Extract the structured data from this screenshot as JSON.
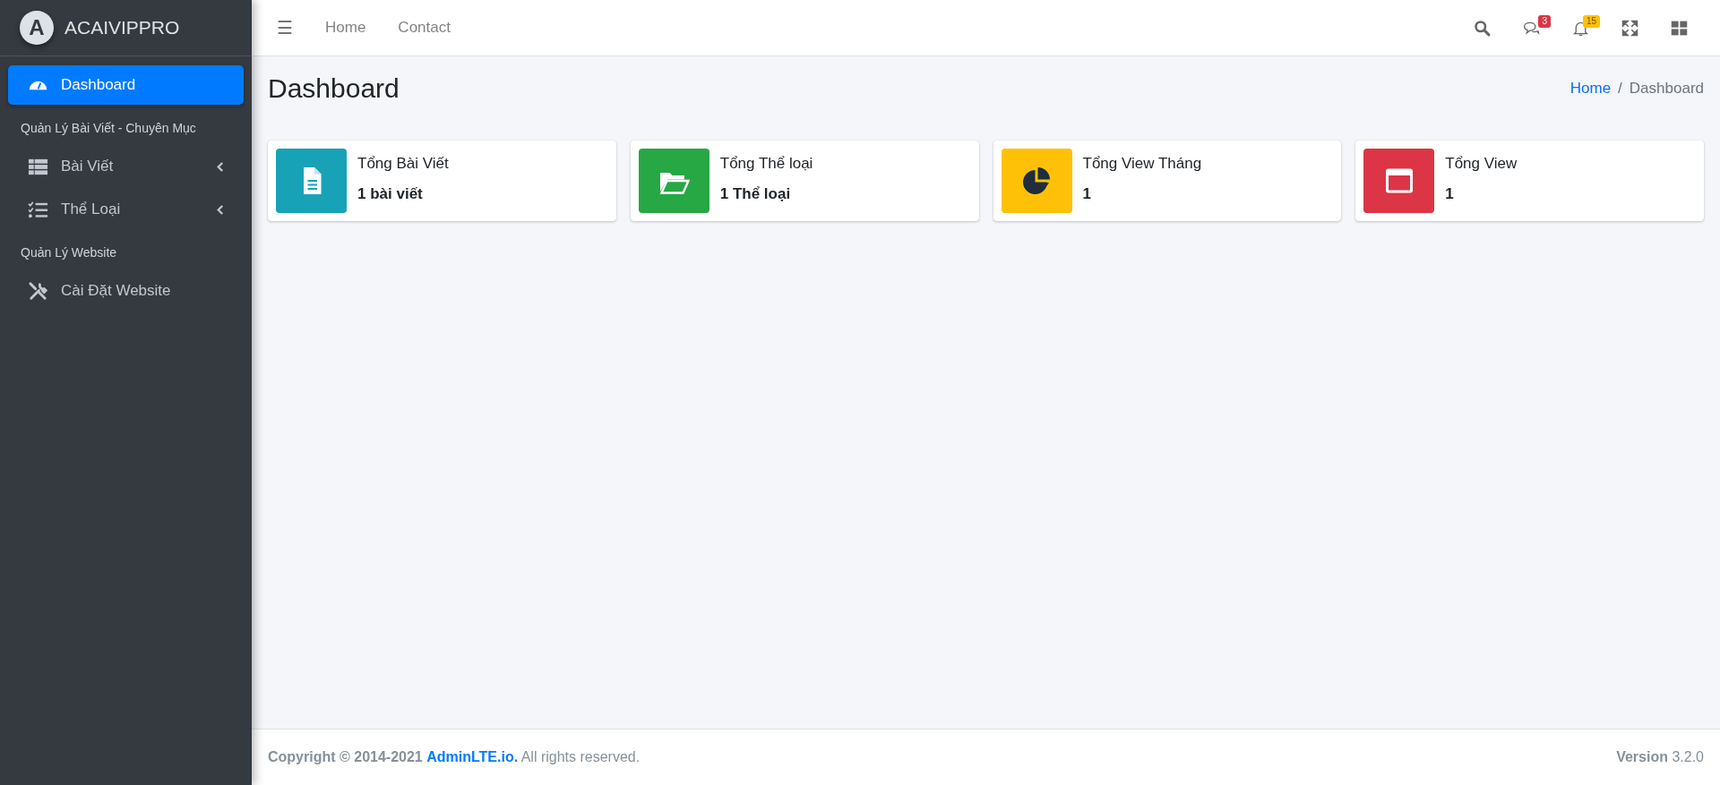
{
  "brand": {
    "initial": "A",
    "name": "ACAIVIPPRO"
  },
  "sidebar": {
    "items": [
      {
        "kind": "link",
        "label": "Dashboard",
        "selected": true,
        "expandable": false
      },
      {
        "kind": "header",
        "label": "Quản Lý Bài Viết - Chuyên Mục"
      },
      {
        "kind": "link",
        "label": "Bài Viết",
        "selected": false,
        "expandable": true
      },
      {
        "kind": "link",
        "label": "Thể Loại",
        "selected": false,
        "expandable": true
      },
      {
        "kind": "header",
        "label": "Quản Lý Website"
      },
      {
        "kind": "link",
        "label": "Cài Đặt Website",
        "selected": false,
        "expandable": false
      }
    ]
  },
  "navbar": {
    "menu_glyph": "☰",
    "links": [
      "Home",
      "Contact"
    ],
    "tools": [
      {
        "kind": "search"
      },
      {
        "kind": "messages",
        "badge": "3",
        "color": "#dc3545"
      },
      {
        "kind": "notifications",
        "badge": "15",
        "color": "#ffc107"
      },
      {
        "kind": "fullscreen"
      },
      {
        "kind": "apps"
      }
    ]
  },
  "page": {
    "title": "Dashboard",
    "breadcrumb_separator": "/",
    "breadcrumb": [
      {
        "label": "Home",
        "selected": false
      },
      {
        "label": "Dashboard",
        "selected": true
      }
    ]
  },
  "info_boxes": [
    {
      "kind": "document",
      "color": "#17a2b8",
      "title": "Tổng Bài Viết",
      "value": "1 bài viết"
    },
    {
      "kind": "folder",
      "color": "#28a745",
      "title": "Tổng Thể loại",
      "value": "1 Thể loại"
    },
    {
      "kind": "pie",
      "color": "#ffc107",
      "title": "Tổng View Tháng",
      "value": "1"
    },
    {
      "kind": "window",
      "color": "#dc3545",
      "title": "Tổng View",
      "value": "1"
    }
  ],
  "footer": {
    "copyright": "Copyright © 2014-2021",
    "link": "AdminLTE.io.",
    "rights": "All rights reserved.",
    "version": "**Version** 3.2.0"
  }
}
